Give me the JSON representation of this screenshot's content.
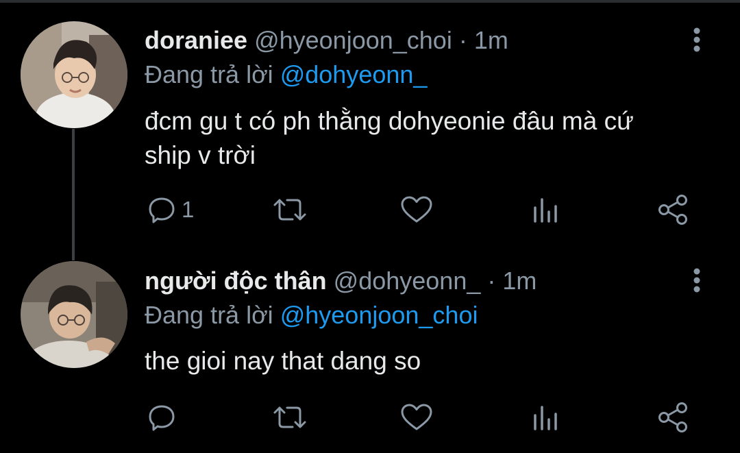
{
  "tweets": [
    {
      "display_name": "doraniee",
      "handle": "@hyeonjoon_choi",
      "separator": "·",
      "time": "1m",
      "reply_prefix": "Đang trả lời",
      "reply_to": "@dohyeonn_",
      "text_line1": "đcm gu t có ph thằng dohyeonie đâu mà cứ",
      "text_line2": "ship v trời",
      "reply_count": "1",
      "avatar_icon": "profile-photo"
    },
    {
      "display_name": "người độc thân",
      "handle": "@dohyeonn_",
      "separator": "·",
      "time": "1m",
      "reply_prefix": "Đang trả lời",
      "reply_to": "@hyeonjoon_choi",
      "text_line1": "the gioi nay that dang so",
      "reply_count": "",
      "avatar_icon": "profile-photo"
    }
  ],
  "icons": {
    "reply": "reply-icon",
    "retweet": "retweet-icon",
    "like": "heart-icon",
    "analytics": "analytics-icon",
    "share": "share-icon",
    "more": "more-vertical-icon"
  },
  "colors": {
    "background": "#000000",
    "text": "#e7e9ea",
    "secondary": "#8b98a5",
    "mention": "#1d9bf0",
    "thread_line": "#3a3f45"
  }
}
